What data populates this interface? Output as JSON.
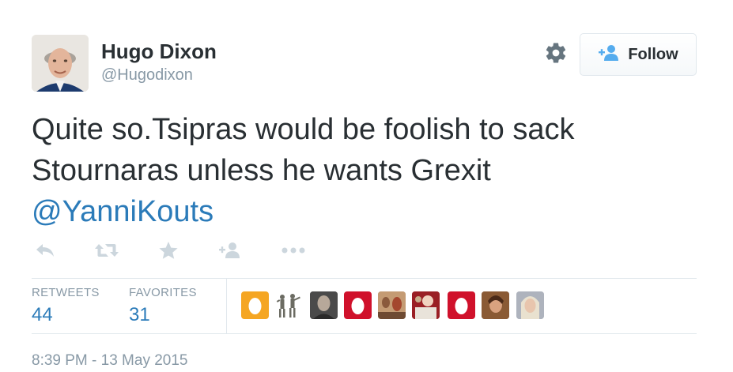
{
  "author": {
    "name": "Hugo Dixon",
    "handle": "@Hugodixon"
  },
  "follow_button": {
    "label": "Follow"
  },
  "tweet": {
    "text": "Quite so.Tsipras would be foolish to sack Stournaras unless he wants Grexit",
    "mention": "@YanniKouts"
  },
  "actions": [
    {
      "name": "reply",
      "icon": "reply-icon"
    },
    {
      "name": "retweet",
      "icon": "retweet-icon"
    },
    {
      "name": "favorite",
      "icon": "star-icon"
    },
    {
      "name": "follow",
      "icon": "follow-user-icon"
    },
    {
      "name": "more",
      "icon": "more-dots-icon"
    }
  ],
  "stats": {
    "retweets_label": "RETWEETS",
    "retweets_count": "44",
    "favorites_label": "FAVORITES",
    "favorites_count": "31"
  },
  "timestamp": "8:39 PM - 13 May 2015",
  "colors": {
    "link": "#2b7bb9",
    "muted": "#8899a6",
    "text": "#292f33",
    "icon": "#ccd6dd",
    "egg_orange": "#f5a623",
    "egg_red": "#d0112b"
  }
}
